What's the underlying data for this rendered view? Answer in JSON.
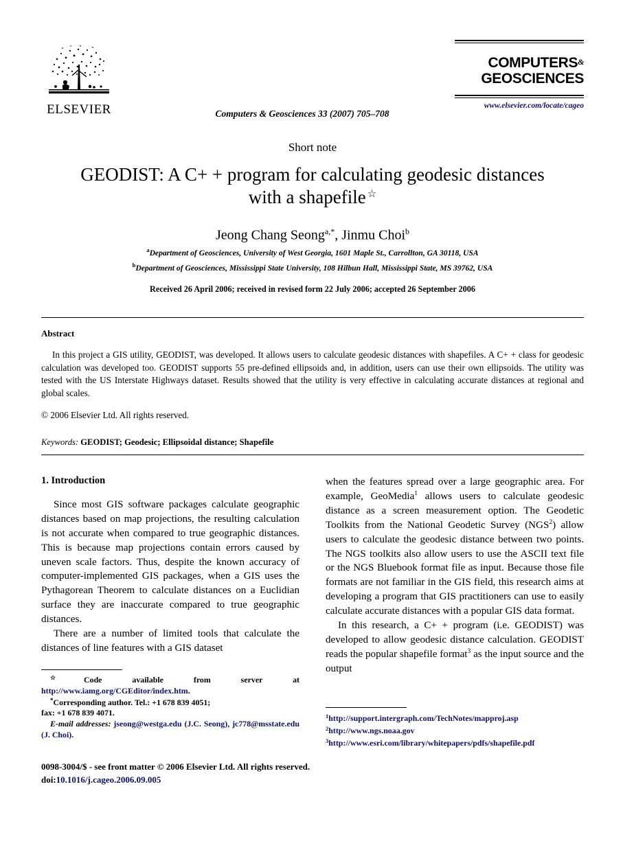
{
  "masthead": {
    "publisher_name": "ELSEVIER",
    "publisher_logo_icon": "elsevier-tree-logo",
    "journal_reference": "Computers & Geosciences 33 (2007) 705–708",
    "brand_line1": "COMPUTERS",
    "brand_amp": "&",
    "brand_line2": "GEOSCIENCES",
    "brand_url": "www.elsevier.com/locate/cageo"
  },
  "article": {
    "category": "Short note",
    "title": "GEODIST: A C+ + program for calculating geodesic distances with a shapefile",
    "title_footnote_mark": "☆",
    "authors": "Jeong Chang Seong",
    "author1_marks": "a,*",
    "authors_second": ", Jinmu Choi",
    "author2_marks": "b",
    "affiliation_a_mark": "a",
    "affiliation_a": "Department of Geosciences, University of West Georgia, 1601 Maple St., Carrollton, GA 30118, USA",
    "affiliation_b_mark": "b",
    "affiliation_b": "Department of Geosciences, Mississippi State University, 108 Hilbun Hall, Mississippi State, MS 39762, USA",
    "dates": "Received 26 April 2006; received in revised form 22 July 2006; accepted 26 September 2006"
  },
  "abstract": {
    "heading": "Abstract",
    "body": "In this project a GIS utility, GEODIST, was developed. It allows users to calculate geodesic distances with shapefiles. A C+ + class for geodesic calculation was developed too. GEODIST supports 55 pre-defined ellipsoids and, in addition, users can use their own ellipsoids. The utility was tested with the US Interstate Highways dataset. Results showed that the utility is very effective in calculating accurate distances at regional and global scales.",
    "copyright": "© 2006 Elsevier Ltd. All rights reserved.",
    "keywords_label": "Keywords:",
    "keywords_values": "GEODIST; Geodesic; Ellipsoidal distance; Shapefile"
  },
  "body": {
    "section_heading": "1.  Introduction",
    "left_par1": "Since most GIS software packages calculate geographic distances based on map projections, the resulting calculation is not accurate when compared to true geographic distances. This is because map projections contain errors caused by uneven scale factors. Thus, despite the known accuracy of computer-implemented GIS packages, when a GIS uses the Pythagorean Theorem to calculate distances on a Euclidian surface they are inaccurate compared to true geographic distances.",
    "left_par2": "There are a number of limited tools that calculate the distances of line features with a GIS dataset",
    "right_par1_a": "when the features spread over a large geographic area. For example, GeoMedia",
    "right_par1_sup1": "1",
    "right_par1_b": " allows users to calculate geodesic distance as a screen measurement option. The Geodetic Toolkits from the National Geodetic Survey (NGS",
    "right_par1_sup2": "2",
    "right_par1_c": ") allow users to calculate the geodesic distance between two points. The NGS toolkits also allow users to use the ASCII text file or the NGS Bluebook format file as input. Because those file formats are not familiar in the GIS field, this research aims at developing a program that GIS practitioners can use to easily calculate accurate distances with a popular GIS data format.",
    "right_par2_a": "In this research, a C+ + program (i.e. GEODIST) was developed to allow geodesic distance calculation. GEODIST reads the popular shapefile format",
    "right_par2_sup3": "3",
    "right_par2_b": " as the input source and the output"
  },
  "footnotes": {
    "star_mark": "☆",
    "star_text_a": "Code available from server at ",
    "star_link": "http://www.iamg.org/CGEditor/index.htm",
    "star_text_b": ".",
    "corresponding_mark": "*",
    "corresponding_text": "Corresponding author. Tel.: +1 678 839 4051;",
    "fax_text": "fax: +1 678 839 4071.",
    "email_label": "E-mail addresses:",
    "email_1": "jseong@westga.edu",
    "email_1_owner": " (J.C. Seong), ",
    "email_2": "jc778@msstate.edu",
    "email_2_owner": " (J. Choi).",
    "numbered": [
      {
        "num": "1",
        "url": "http://support.intergraph.com/TechNotes/mapproj.asp"
      },
      {
        "num": "2",
        "url": "http://www.ngs.noaa.gov"
      },
      {
        "num": "3",
        "url": "http://www.esri.com/library/whitepapers/pdfs/shapefile.pdf"
      }
    ]
  },
  "imprint": {
    "issn_line": "0098-3004/$ - see front matter © 2006 Elsevier Ltd. All rights reserved.",
    "doi_label": "doi:",
    "doi_value": "10.1016/j.cageo.2006.09.005"
  },
  "colors": {
    "link": "#111166",
    "text": "#000000",
    "background": "#ffffff"
  }
}
